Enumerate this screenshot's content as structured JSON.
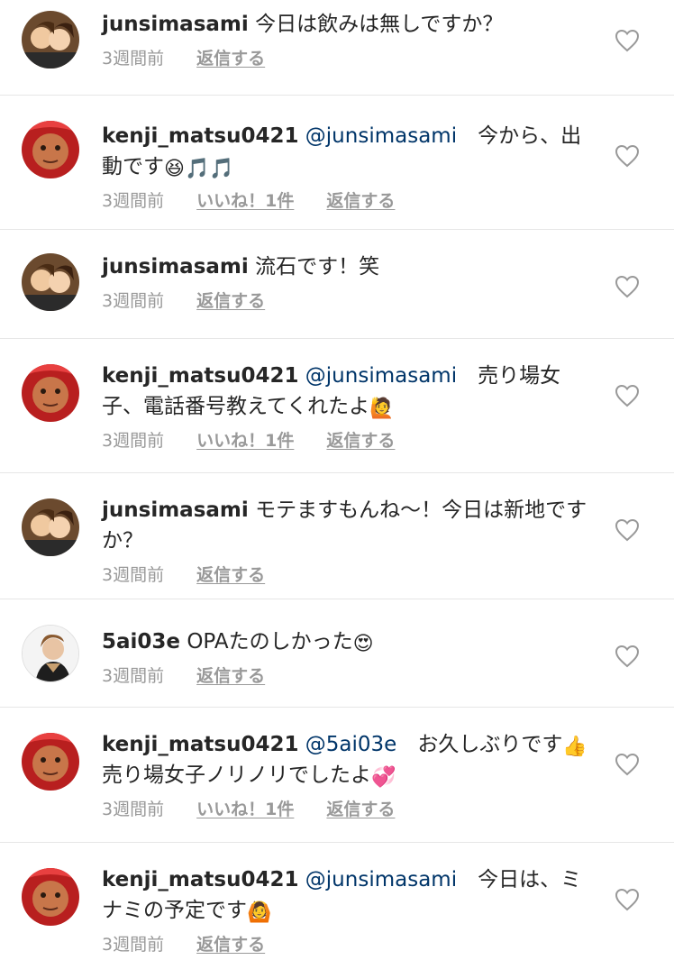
{
  "comments": [
    {
      "username": "junsimasami",
      "mention": "",
      "text_parts": [
        "今日は飲みは無しですか？"
      ],
      "emojis": [],
      "time": "3週間前",
      "likes": "",
      "reply": "返信する",
      "avatar": "avatar-junsimasami"
    },
    {
      "username": "kenji_matsu0421",
      "mention": "@junsimasami",
      "text_parts": [
        "　今から、出動です"
      ],
      "emojis": [
        "😆",
        "🎵",
        "🎵"
      ],
      "time": "3週間前",
      "likes": "いいね！1件",
      "reply": "返信する",
      "avatar": "avatar-kenji"
    },
    {
      "username": "junsimasami",
      "mention": "",
      "text_parts": [
        "流石です！笑"
      ],
      "emojis": [],
      "time": "3週間前",
      "likes": "",
      "reply": "返信する",
      "avatar": "avatar-junsimasami"
    },
    {
      "username": "kenji_matsu0421",
      "mention": "@junsimasami",
      "text_parts": [
        "　売り場女子、電話番号教えてくれたよ"
      ],
      "emojis": [
        "🙋"
      ],
      "time": "3週間前",
      "likes": "いいね！1件",
      "reply": "返信する",
      "avatar": "avatar-kenji"
    },
    {
      "username": "junsimasami",
      "mention": "",
      "text_parts": [
        "モテますもんね〜！今日は新地ですか？"
      ],
      "emojis": [],
      "time": "3週間前",
      "likes": "",
      "reply": "返信する",
      "avatar": "avatar-junsimasami"
    },
    {
      "username": "5ai03e",
      "mention": "",
      "text_parts": [
        "OPAたのしかった"
      ],
      "emojis": [
        "😍"
      ],
      "time": "3週間前",
      "likes": "",
      "reply": "返信する",
      "avatar": "avatar-5ai03e"
    },
    {
      "username": "kenji_matsu0421",
      "mention": "@5ai03e",
      "text_parts": [
        "　お久しぶりです",
        "売り場女子ノリノリでしたよ"
      ],
      "emojis": [
        "👍",
        "💞"
      ],
      "time": "3週間前",
      "likes": "いいね！1件",
      "reply": "返信する",
      "avatar": "avatar-kenji"
    },
    {
      "username": "kenji_matsu0421",
      "mention": "@junsimasami",
      "text_parts": [
        "　今日は、ミナミの予定です"
      ],
      "emojis": [
        "🙆"
      ],
      "time": "3週間前",
      "likes": "",
      "reply": "返信する",
      "avatar": "avatar-kenji"
    }
  ],
  "colors": {
    "username": "#262626",
    "mention": "#003569",
    "meta": "#999999",
    "divider": "#e6e6e6"
  }
}
